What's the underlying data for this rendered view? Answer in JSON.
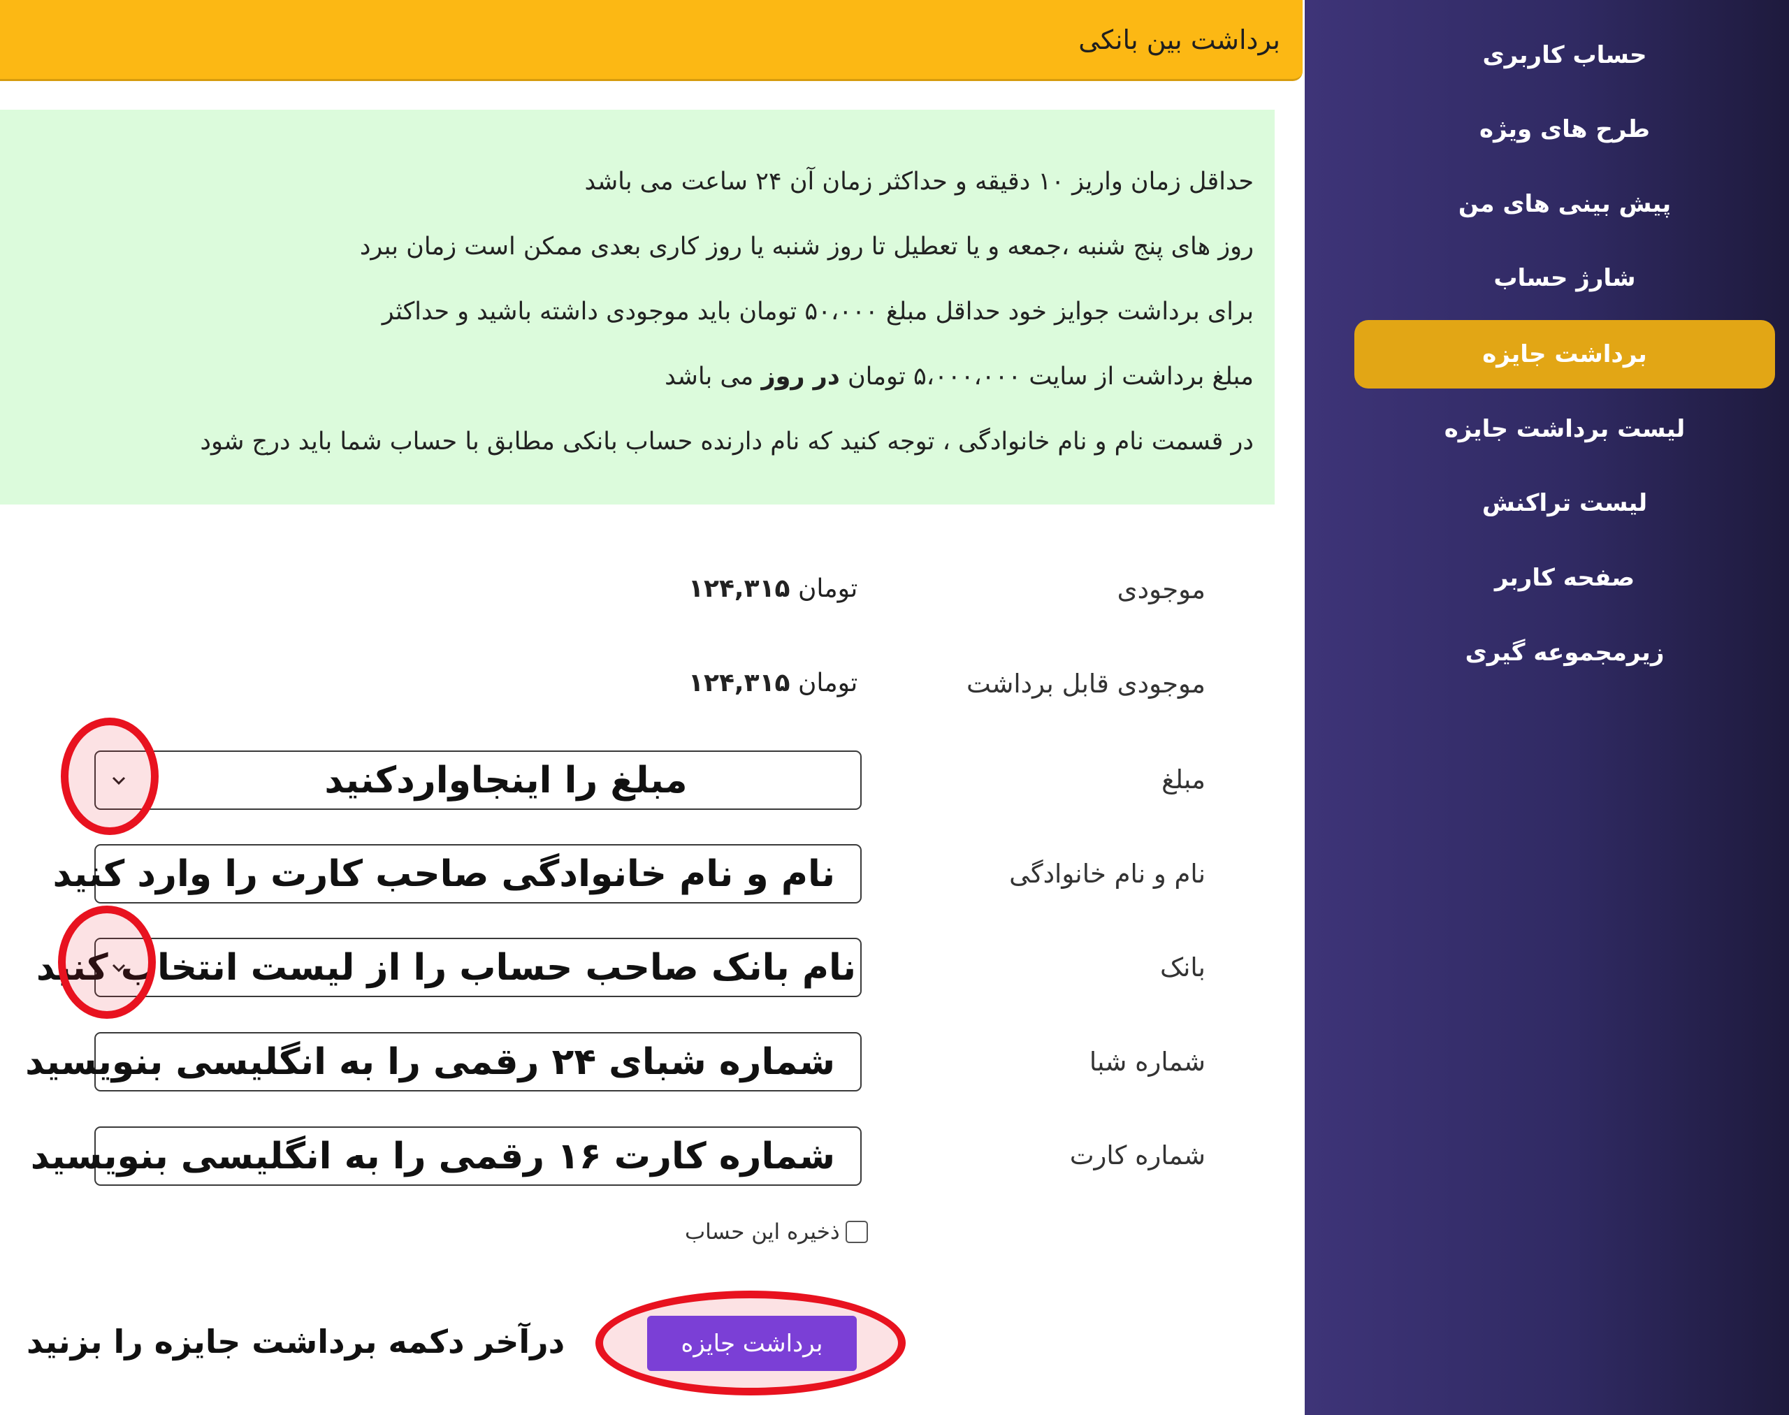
{
  "sidebar": {
    "items": [
      {
        "label": "حساب کاربری"
      },
      {
        "label": "طرح های ویژه"
      },
      {
        "label": "پیش بینی های من"
      },
      {
        "label": "شارژ حساب"
      },
      {
        "label": "برداشت جایزه",
        "active": true
      },
      {
        "label": "لیست برداشت جایزه"
      },
      {
        "label": "لیست تراکنش"
      },
      {
        "label": "صفحه کاربر"
      },
      {
        "label": "زیرمجموعه گیری"
      }
    ]
  },
  "header": {
    "title": "برداشت بین بانکی"
  },
  "info": {
    "line1": "حداقل زمان واریز ۱۰ دقیقه و حداکثر زمان آن ۲۴ ساعت می باشد",
    "line2": "روز های پنج شنبه ،جمعه و یا تعطیل تا روز شنبه یا روز کاری بعدی ممکن است زمان ببرد",
    "line3": "برای برداشت جوایز خود حداقل مبلغ  ۵۰،۰۰۰  تومان باید موجودی داشته باشید و حداکثر",
    "line4_part1": "مبلغ برداشت از سایت ۵،۰۰۰،۰۰۰ تومان",
    "line4_bold": "در روز",
    "line4_part2": "می باشد",
    "line5": "در قسمت نام و نام خانوادگی ، توجه کنید که نام دارنده حساب بانکی مطابق با حساب شما باید درج شود"
  },
  "form": {
    "balance_label": "موجودی",
    "balance_currency": "تومان",
    "balance_value": "۱۲۴,۳۱۵",
    "withdrawable_label": "موجودی قابل برداشت",
    "withdrawable_currency": "تومان",
    "withdrawable_value": "۱۲۴,۳۱۵",
    "amount_label": "مبلغ",
    "amount_text": "مبلغ را اینجاواردکنید",
    "fullname_label": "نام و نام خانوادگی",
    "fullname_text": "نام و نام خانوادگی صاحب کارت را وارد کنید",
    "bank_label": "بانک",
    "bank_text": "نام بانک صاحب حساب را از لیست انتخاب کنید",
    "sheba_label": "شماره شبا",
    "sheba_text": "شماره شبای ۲۴ رقمی را به انگلیسی بنویسید",
    "card_label": "شماره کارت",
    "card_text": "شماره کارت ۱۶ رقمی را به انگلیسی بنویسید",
    "save_label": "ذخیره این حساب",
    "submit_label": "برداشت جایزه"
  },
  "annotation": {
    "final_note": "درآخر دکمه برداشت جایزه را بزنید"
  },
  "colors": {
    "accent": "#fcb814",
    "sidebar": "#302a63",
    "active_item": "#e2a615",
    "info_bg": "#dcfbdc",
    "button": "#7b3fd6",
    "annotation_red": "#e8121f"
  }
}
